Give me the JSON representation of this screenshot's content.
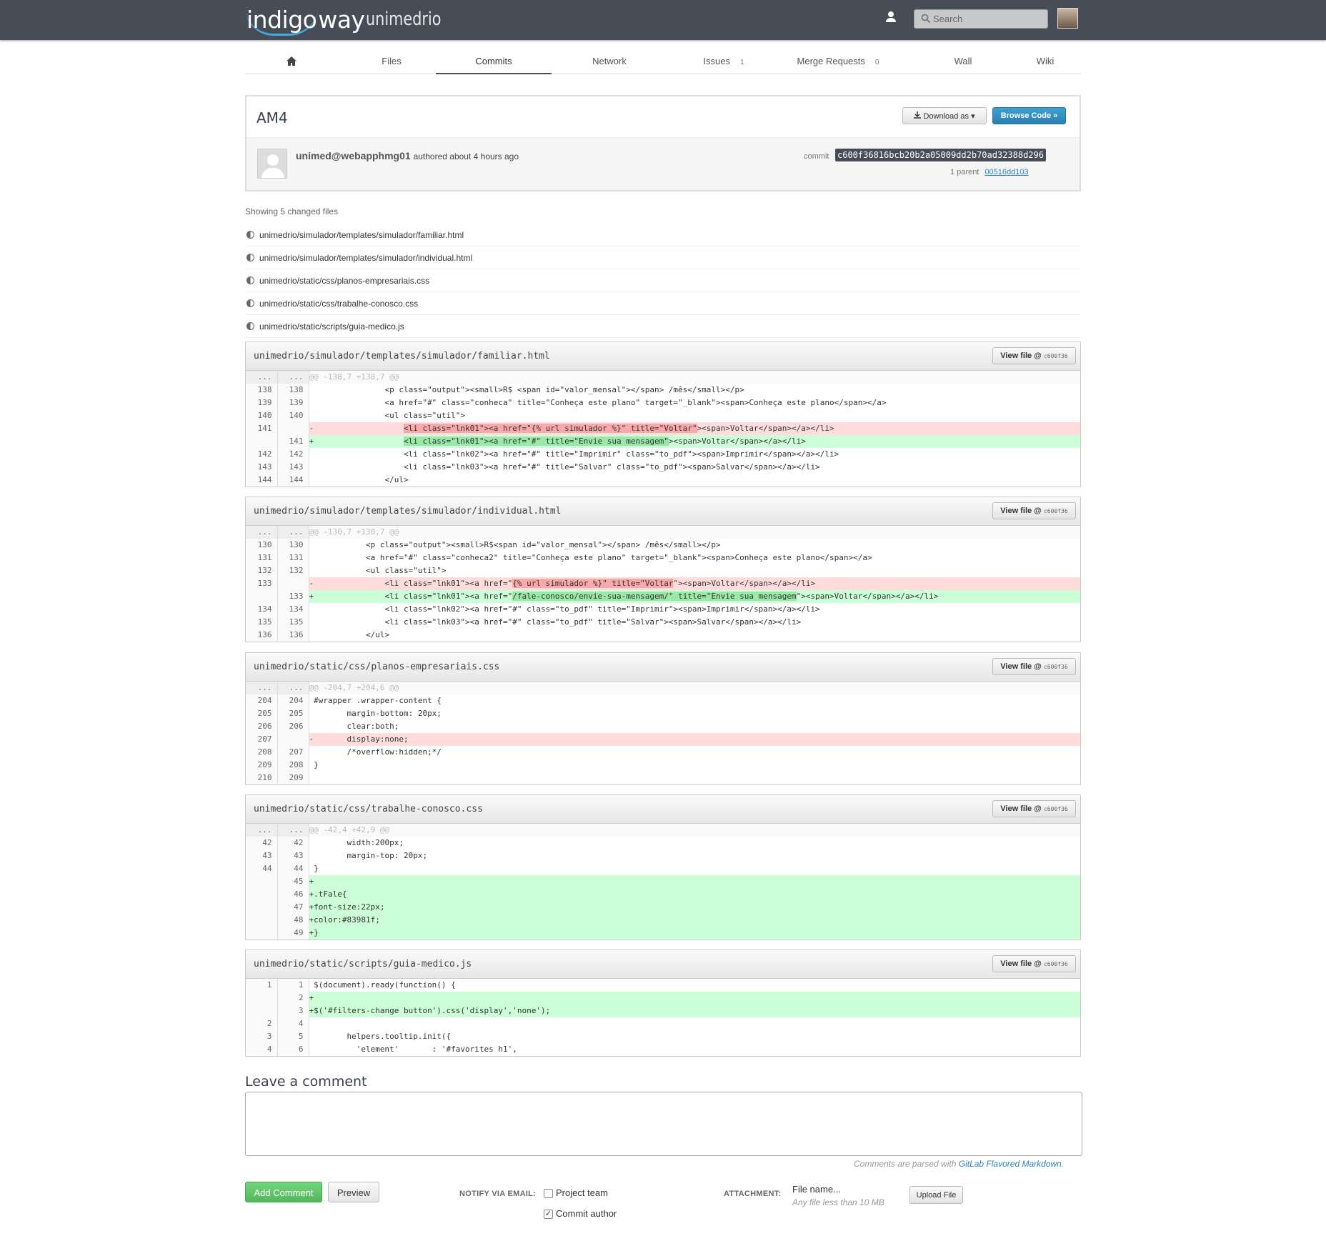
{
  "header": {
    "logo": "indigoway",
    "logo_a": "indigo",
    "logo_b": "way",
    "project": "unimedrio",
    "search_placeholder": "Search"
  },
  "nav": {
    "tabs": [
      {
        "label": "",
        "icon": "home-icon"
      },
      {
        "label": "Files"
      },
      {
        "label": "Commits",
        "active": true
      },
      {
        "label": "Network"
      },
      {
        "label": "Issues",
        "count": "1"
      },
      {
        "label": "Merge Requests",
        "count": "0"
      },
      {
        "label": "Wall"
      },
      {
        "label": "Wiki"
      }
    ]
  },
  "commit": {
    "title": "AM4",
    "download_label": "Download as",
    "browse_label": "Browse Code »",
    "author": "unimed@webapphmg01",
    "authored": "authored about 4 hours ago",
    "sha_label": "commit",
    "sha": "c600f36816bcb20b2a05009dd2b70ad32388d296",
    "parent_label": "1 parent",
    "parent_sha": "00516dd103"
  },
  "files": {
    "showing": "Showing 5 changed files",
    "list": [
      "unimedrio/simulador/templates/simulador/familiar.html",
      "unimedrio/simulador/templates/simulador/individual.html",
      "unimedrio/static/css/planos-empresariais.css",
      "unimedrio/static/css/trabalhe-conosco.css",
      "unimedrio/static/scripts/guia-medico.js"
    ]
  },
  "view_file": {
    "label": "View file @",
    "sha": "c600f36"
  },
  "diffs": [
    {
      "file": "unimedrio/simulador/templates/simulador/familiar.html",
      "lines": [
        {
          "t": "hunk",
          "o": "...",
          "n": "...",
          "c": "@@ -138,7 +138,7 @@"
        },
        {
          "t": "ctx",
          "o": "138",
          "n": "138",
          "c": "                <p class=\"output\"><small>R$ <span id=\"valor_mensal\"></span> /mês</small></p>"
        },
        {
          "t": "ctx",
          "o": "139",
          "n": "139",
          "c": "                <a href=\"#\" class=\"conheca\" title=\"Conheça este plano\" target=\"_blank\"><span>Conheça este plano</span></a>"
        },
        {
          "t": "ctx",
          "o": "140",
          "n": "140",
          "c": "                <ul class=\"util\">"
        },
        {
          "t": "old",
          "o": "141",
          "n": "",
          "pre": "-                   ",
          "hl": "<li class=\"lnk01\"><a href=\"{% url simulador %}\" title=\"Voltar\"",
          "post": "><span>Voltar</span></a></li>"
        },
        {
          "t": "new",
          "o": "",
          "n": "141",
          "pre": "+                   ",
          "hl": "<li class=\"lnk01\"><a href=\"#\" title=\"Envie sua mensagem\"",
          "post": "><span>Voltar</span></a></li>"
        },
        {
          "t": "ctx",
          "o": "142",
          "n": "142",
          "c": "                    <li class=\"lnk02\"><a href=\"#\" title=\"Imprimir\" class=\"to_pdf\"><span>Imprimir</span></a></li>"
        },
        {
          "t": "ctx",
          "o": "143",
          "n": "143",
          "c": "                    <li class=\"lnk03\"><a href=\"#\" title=\"Salvar\" class=\"to_pdf\"><span>Salvar</span></a></li>"
        },
        {
          "t": "ctx",
          "o": "144",
          "n": "144",
          "c": "                </ul>"
        }
      ]
    },
    {
      "file": "unimedrio/simulador/templates/simulador/individual.html",
      "lines": [
        {
          "t": "hunk",
          "o": "...",
          "n": "...",
          "c": "@@ -130,7 +130,7 @@"
        },
        {
          "t": "ctx",
          "o": "130",
          "n": "130",
          "c": "            <p class=\"output\"><small>R$<span id=\"valor_mensal\"></span> /mês</small></p>"
        },
        {
          "t": "ctx",
          "o": "131",
          "n": "131",
          "c": "            <a href=\"#\" class=\"conheca2\" title=\"Conheça este plano\" target=\"_blank\"><span>Conheça este plano</span></a>"
        },
        {
          "t": "ctx",
          "o": "132",
          "n": "132",
          "c": "            <ul class=\"util\">"
        },
        {
          "t": "old",
          "o": "133",
          "n": "",
          "pre": "-               <li class=\"lnk01\"><a href=\"",
          "hl": "{% url simulador %}\" title=\"Voltar",
          "post": "\"><span>Voltar</span></a></li>"
        },
        {
          "t": "new",
          "o": "",
          "n": "133",
          "pre": "+               <li class=\"lnk01\"><a href=\"",
          "hl": "/fale-conosco/envie-sua-mensagem/\" title=\"Envie sua mensagem",
          "post": "\"><span>Voltar</span></a></li>"
        },
        {
          "t": "ctx",
          "o": "134",
          "n": "134",
          "c": "                <li class=\"lnk02\"><a href=\"#\" class=\"to_pdf\" title=\"Imprimir\"><span>Imprimir</span></a></li>"
        },
        {
          "t": "ctx",
          "o": "135",
          "n": "135",
          "c": "                <li class=\"lnk03\"><a href=\"#\" class=\"to_pdf\" title=\"Salvar\"><span>Salvar</span></a></li>"
        },
        {
          "t": "ctx",
          "o": "136",
          "n": "136",
          "c": "            </ul>"
        }
      ]
    },
    {
      "file": "unimedrio/static/css/planos-empresariais.css",
      "lines": [
        {
          "t": "hunk",
          "o": "...",
          "n": "...",
          "c": "@@ -204,7 +204,6 @@"
        },
        {
          "t": "ctx",
          "o": "204",
          "n": "204",
          "c": " #wrapper .wrapper-content {"
        },
        {
          "t": "ctx",
          "o": "205",
          "n": "205",
          "c": "        margin-bottom: 20px;"
        },
        {
          "t": "ctx",
          "o": "206",
          "n": "206",
          "c": "        clear:both;"
        },
        {
          "t": "old",
          "o": "207",
          "n": "",
          "c": "-       display:none;"
        },
        {
          "t": "ctx",
          "o": "208",
          "n": "207",
          "c": "        /*overflow:hidden;*/"
        },
        {
          "t": "ctx",
          "o": "209",
          "n": "208",
          "c": " }"
        },
        {
          "t": "ctx",
          "o": "210",
          "n": "209",
          "c": ""
        }
      ]
    },
    {
      "file": "unimedrio/static/css/trabalhe-conosco.css",
      "lines": [
        {
          "t": "hunk",
          "o": "...",
          "n": "...",
          "c": "@@ -42,4 +42,9 @@"
        },
        {
          "t": "ctx",
          "o": "42",
          "n": "42",
          "c": "        width:200px;"
        },
        {
          "t": "ctx",
          "o": "43",
          "n": "43",
          "c": "        margin-top: 20px;"
        },
        {
          "t": "ctx",
          "o": "44",
          "n": "44",
          "c": " }"
        },
        {
          "t": "new",
          "o": "",
          "n": "45",
          "c": "+"
        },
        {
          "t": "new",
          "o": "",
          "n": "46",
          "c": "+.tFale{"
        },
        {
          "t": "new",
          "o": "",
          "n": "47",
          "c": "+font-size:22px;"
        },
        {
          "t": "new",
          "o": "",
          "n": "48",
          "c": "+color:#83981f;"
        },
        {
          "t": "new",
          "o": "",
          "n": "49",
          "c": "+}"
        }
      ]
    },
    {
      "file": "unimedrio/static/scripts/guia-medico.js",
      "lines": [
        {
          "t": "ctx",
          "o": "1",
          "n": "1",
          "c": " $(document).ready(function() {"
        },
        {
          "t": "new",
          "o": "",
          "n": "2",
          "c": "+"
        },
        {
          "t": "new",
          "o": "",
          "n": "3",
          "c": "+$('#filters-change button').css('display','none');"
        },
        {
          "t": "ctx",
          "o": "2",
          "n": "4",
          "c": ""
        },
        {
          "t": "ctx",
          "o": "3",
          "n": "5",
          "c": "        helpers.tooltip.init({"
        },
        {
          "t": "ctx",
          "o": "4",
          "n": "6",
          "c": "          'element'       : '#favorites h1',"
        }
      ]
    }
  ],
  "comment": {
    "heading": "Leave a comment",
    "md_prefix": "Comments are parsed with",
    "md_link": "GitLab Flavored Markdown",
    "add_label": "Add Comment",
    "preview_label": "Preview",
    "notify_label": "NOTIFY VIA EMAIL:",
    "project_team": "Project team",
    "commit_author": "Commit author",
    "attachment_label": "ATTACHMENT:",
    "file_name": "File name...",
    "file_limit": "Any file less than 10 MB",
    "upload_label": "Upload File"
  },
  "colors": {
    "topbar": "#474d57",
    "removed": "#ffdddd",
    "added": "#ccffd8",
    "accent": "#2a86c0"
  }
}
